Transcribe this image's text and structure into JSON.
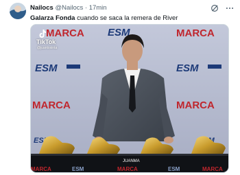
{
  "tweet": {
    "author_name": "Nailocs",
    "author_handle": "@Nailocs",
    "separator": "·",
    "time": "17min",
    "text_bold": "Galarza Fonda",
    "text_rest": " cuando se saca la remera de River"
  },
  "media": {
    "watermark_app": "TikTok",
    "watermark_user": "@juantoxinta",
    "backdrop_logos": [
      "MARCA",
      "ESM"
    ],
    "nameplate": "JUANMA"
  },
  "icons": {
    "avatar": "avatar-icon",
    "grok": "grok-icon",
    "more": "more-icon",
    "tiktok": "tiktok-icon"
  },
  "colors": {
    "text_primary": "#0f1419",
    "text_secondary": "#536471",
    "marca_red": "#c0262d",
    "esm_blue": "#1d3a78",
    "backdrop": "#b4bacf",
    "gold": "#c89b2c"
  }
}
